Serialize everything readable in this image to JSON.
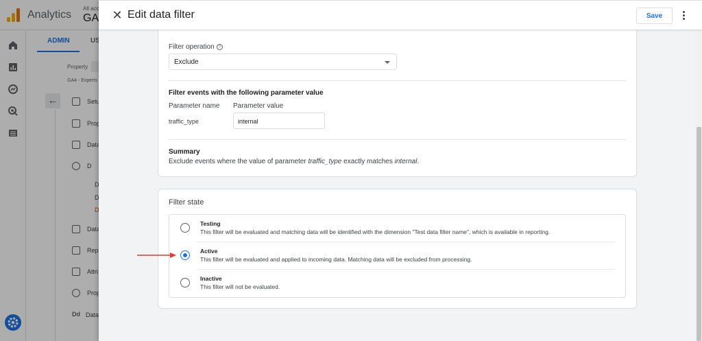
{
  "background": {
    "app_name": "Analytics",
    "account_line1": "All acc",
    "account_line2": "GA",
    "tabs": [
      "ADMIN",
      "US"
    ],
    "property_label": "Property",
    "property_name": "GA4 - Experts",
    "menu_items": [
      "Setu",
      "Prop",
      "Data",
      "D",
      "Data",
      "Repo",
      "Attri",
      "Prop",
      "Data"
    ],
    "sub_items": [
      "D",
      "D",
      "D"
    ]
  },
  "panel": {
    "title": "Edit data filter",
    "save_label": "Save",
    "filter_operation": {
      "label": "Filter operation",
      "value": "Exclude"
    },
    "parameter_section": {
      "heading": "Filter events with the following parameter value",
      "name_header": "Parameter name",
      "value_header": "Parameter value",
      "name": "traffic_type",
      "value": "internal"
    },
    "summary": {
      "heading": "Summary",
      "text_before": "Exclude events where the value of parameter ",
      "param": "traffic_type",
      "text_middle": " exactly matches ",
      "match": "internal",
      "text_after": "."
    },
    "filter_state": {
      "title": "Filter state",
      "options": [
        {
          "label": "Testing",
          "description": "This filter will be evaluated and matching data will be identified with the dimension \"Test data filter name\", which is available in reporting.",
          "checked": false
        },
        {
          "label": "Active",
          "description": "This filter will be evaluated and applied to incoming data. Matching data will be excluded from processing.",
          "checked": true
        },
        {
          "label": "Inactive",
          "description": "This filter will not be evaluated.",
          "checked": false
        }
      ]
    }
  },
  "colors": {
    "accent": "#1a73e8",
    "annotation_arrow": "#e53935",
    "logo": "#f9ab00"
  }
}
